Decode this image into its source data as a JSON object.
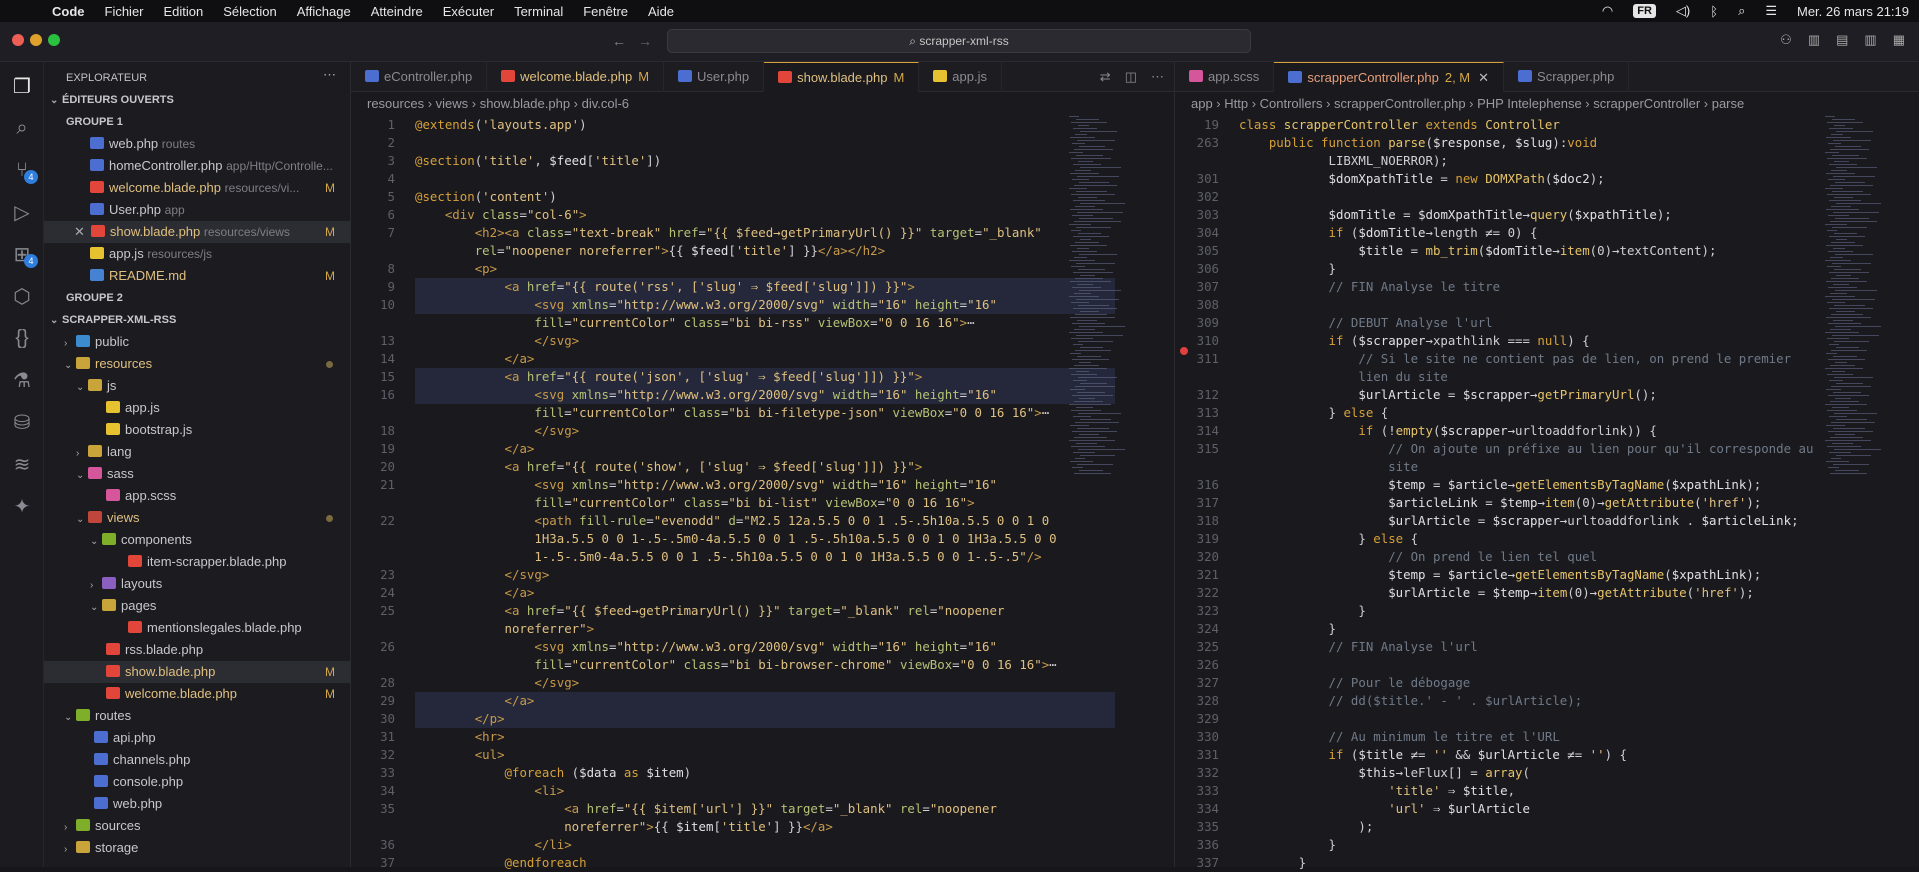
{
  "menubar": {
    "app": "Code",
    "items": [
      "Fichier",
      "Edition",
      "Sélection",
      "Affichage",
      "Atteindre",
      "Exécuter",
      "Terminal",
      "Fenêtre",
      "Aide"
    ],
    "input_lang": "FR",
    "clock": "Mer. 26 mars  21:19"
  },
  "titlebar": {
    "search": "scrapper-xml-rss"
  },
  "activity": {
    "scm_badge": "4",
    "ext_badge": "4"
  },
  "explorer": {
    "title": "EXPLORATEUR",
    "open_editors": "ÉDITEURS OUVERTS",
    "group1": "GROUPE 1",
    "group2": "GROUPE 2",
    "project": "SCRAPPER-XML-RSS",
    "open_files": [
      {
        "name": "web.php",
        "desc": "routes",
        "status": ""
      },
      {
        "name": "homeController.php",
        "desc": "app/Http/Controlle...",
        "status": ""
      },
      {
        "name": "welcome.blade.php",
        "desc": "resources/vi...",
        "status": "M"
      },
      {
        "name": "User.php",
        "desc": "app",
        "status": ""
      },
      {
        "name": "show.blade.php",
        "desc": "resources/views",
        "status": "M"
      },
      {
        "name": "app.js",
        "desc": "resources/js",
        "status": ""
      },
      {
        "name": "README.md",
        "desc": "",
        "status": "M"
      }
    ],
    "tree": [
      "public",
      "resources",
      "js",
      "app.js",
      "bootstrap.js",
      "lang",
      "sass",
      "app.scss",
      "views",
      "components",
      "item-scrapper.blade.php",
      "layouts",
      "pages",
      "mentionslegales.blade.php",
      "rss.blade.php",
      "show.blade.php",
      "welcome.blade.php",
      "routes",
      "api.php",
      "channels.php",
      "console.php",
      "web.php",
      "sources",
      "storage"
    ],
    "tree_status": {
      "show": "M",
      "welcome": "M"
    }
  },
  "left_editor": {
    "tabs": [
      {
        "label": "eController.php",
        "mod": ""
      },
      {
        "label": "welcome.blade.php",
        "mod": "M"
      },
      {
        "label": "User.php",
        "mod": ""
      },
      {
        "label": "show.blade.php",
        "mod": "M"
      },
      {
        "label": "app.js",
        "mod": ""
      }
    ],
    "crumbs": "resources  ›  views  ›  show.blade.php  ›  div.col-6",
    "line_numbers": [
      "1",
      "2",
      "3",
      "4",
      "5",
      "6",
      "7",
      "",
      "8",
      "9",
      "10",
      "",
      "13",
      "14",
      "15",
      "16",
      "",
      "18",
      "19",
      "20",
      "21",
      "",
      "22",
      "",
      "",
      "23",
      "24",
      "25",
      "",
      "26",
      "",
      "28",
      "29",
      "30",
      "31",
      "32",
      "33",
      "34",
      "35",
      "",
      "36",
      "37"
    ]
  },
  "right_editor": {
    "tabs": [
      {
        "label": "app.scss",
        "mod": ""
      },
      {
        "label": "scrapperController.php",
        "mod": "2, M"
      },
      {
        "label": "Scrapper.php",
        "mod": ""
      }
    ],
    "crumbs": "app  ›  Http  ›  Controllers  ›  scrapperController.php  ›  PHP Intelephense  ›  scrapperController  ›  parse",
    "line_numbers": [
      "19",
      "263",
      "",
      "301",
      "302",
      "303",
      "304",
      "305",
      "306",
      "307",
      "308",
      "309",
      "310",
      "311",
      "",
      "312",
      "313",
      "314",
      "315",
      "",
      "316",
      "317",
      "318",
      "319",
      "320",
      "321",
      "322",
      "323",
      "324",
      "325",
      "326",
      "327",
      "328",
      "329",
      "330",
      "331",
      "332",
      "333",
      "334",
      "335",
      "336",
      "337"
    ]
  }
}
